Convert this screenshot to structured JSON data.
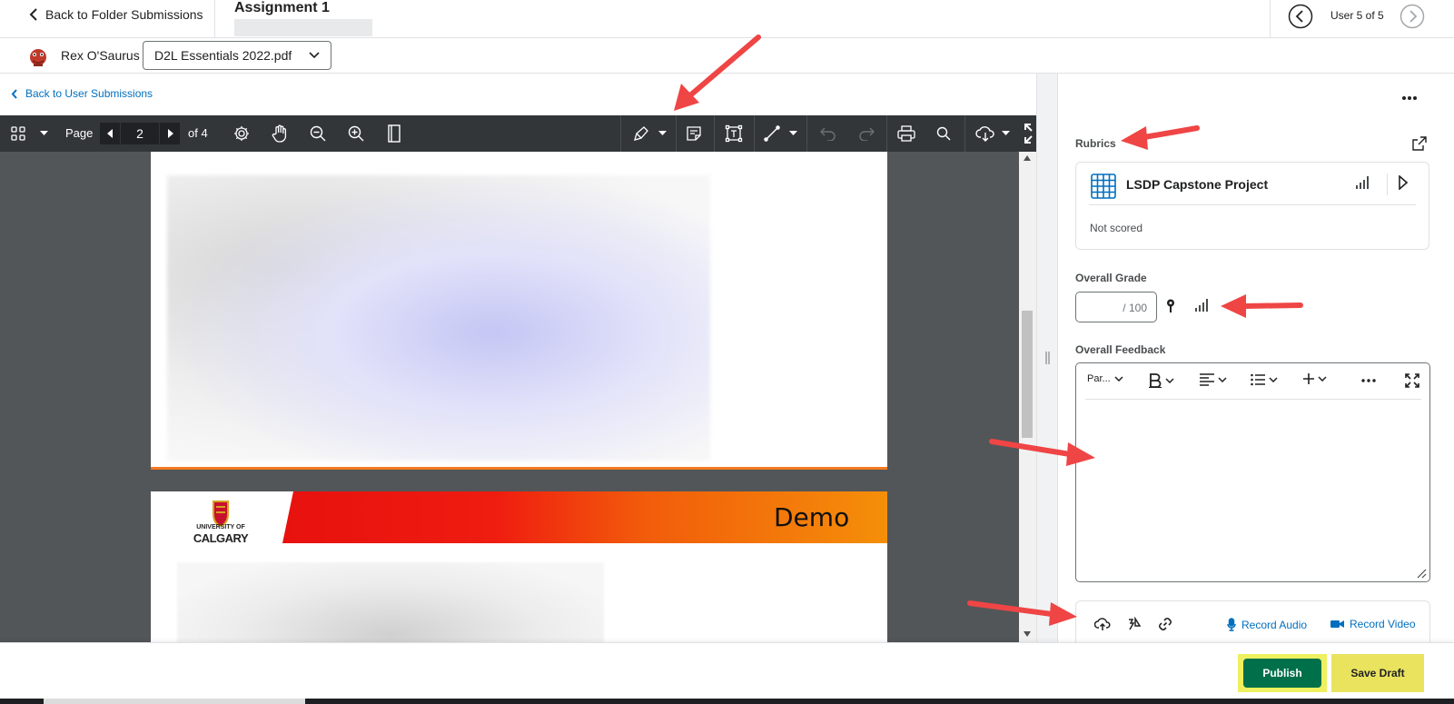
{
  "header": {
    "back_label": "Back to Folder Submissions",
    "assignment_title": "Assignment 1",
    "user_count": "User 5 of 5"
  },
  "user": {
    "name": "Rex O'Saurus",
    "file_selected": "D2L Essentials 2022.pdf"
  },
  "back_user_label": "Back to User Submissions",
  "pdf_toolbar": {
    "page_label": "Page",
    "current_page": "2",
    "of_label": "of 4"
  },
  "pdf_content": {
    "banner_text": "Demo",
    "logo_line1": "UNIVERSITY OF",
    "logo_line2": "CALGARY"
  },
  "rubrics": {
    "label": "Rubrics",
    "rubric_name": "LSDP Capstone Project",
    "status": "Not scored"
  },
  "grade": {
    "label": "Overall Grade",
    "value": "",
    "denominator": "/ 100"
  },
  "feedback": {
    "label": "Overall Feedback",
    "format_label": "Par..."
  },
  "attachments": {
    "record_audio": "Record Audio",
    "record_video": "Record Video"
  },
  "actions": {
    "publish": "Publish",
    "save_draft": "Save Draft"
  },
  "colors": {
    "link": "#006fbf",
    "publish": "#00704a",
    "highlight": "#e9e35e",
    "annotation_arrow": "#ef4545",
    "toolbar": "#323639"
  }
}
